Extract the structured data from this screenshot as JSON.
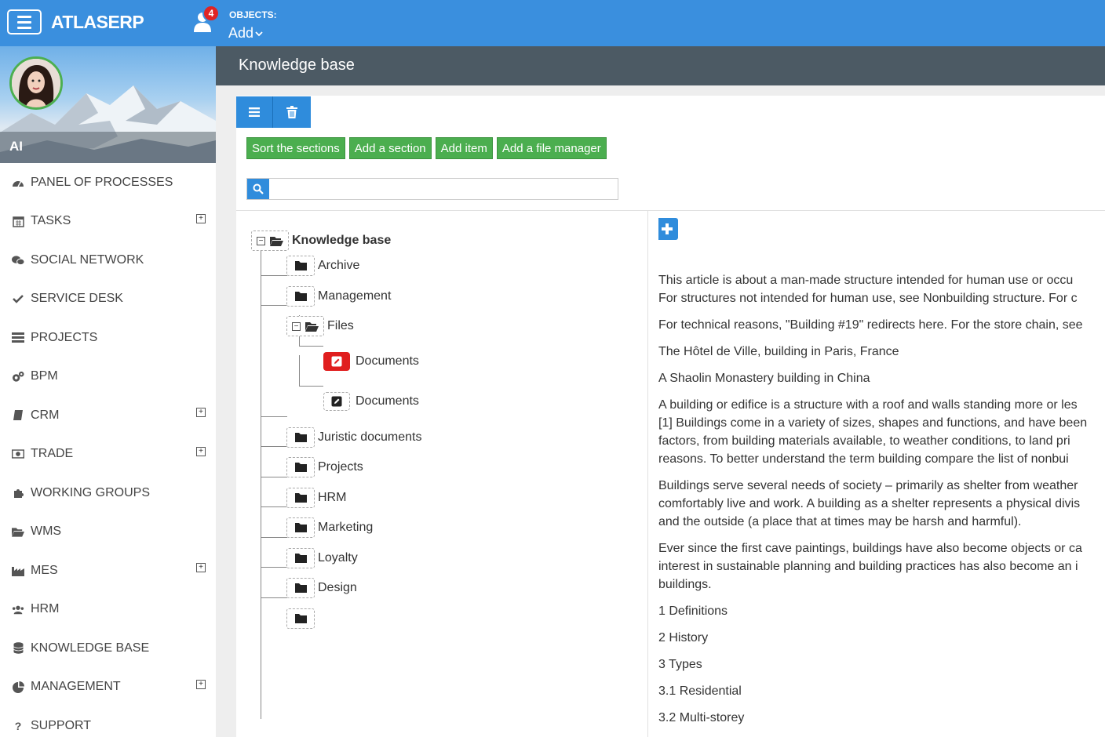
{
  "app": {
    "brand": "ATLASERP",
    "notification_count": "4",
    "objects_label": "OBJECTS:",
    "objects_add": "Add"
  },
  "profile": {
    "name": "AI"
  },
  "menu": [
    {
      "label": "PANEL OF PROCESSES",
      "icon": "dashboard-icon",
      "expandable": false
    },
    {
      "label": "TASKS",
      "icon": "calendar-icon",
      "expandable": true
    },
    {
      "label": "SOCIAL NETWORK",
      "icon": "chat-icon",
      "expandable": false
    },
    {
      "label": "SERVICE DESK",
      "icon": "check-icon",
      "expandable": false
    },
    {
      "label": "PROJECTS",
      "icon": "list-icon",
      "expandable": false
    },
    {
      "label": "BPM",
      "icon": "gears-icon",
      "expandable": false
    },
    {
      "label": "CRM",
      "icon": "book-icon",
      "expandable": true
    },
    {
      "label": "TRADE",
      "icon": "money-icon",
      "expandable": true
    },
    {
      "label": "WORKING GROUPS",
      "icon": "puzzle-icon",
      "expandable": false
    },
    {
      "label": "WMS",
      "icon": "folder-open-icon",
      "expandable": false
    },
    {
      "label": "MES",
      "icon": "factory-icon",
      "expandable": true
    },
    {
      "label": "HRM",
      "icon": "users-icon",
      "expandable": false
    },
    {
      "label": "KNOWLEDGE BASE",
      "icon": "database-icon",
      "expandable": false
    },
    {
      "label": "MANAGEMENT",
      "icon": "pie-chart-icon",
      "expandable": true
    },
    {
      "label": "SUPPORT",
      "icon": "question-icon",
      "expandable": false
    }
  ],
  "page": {
    "title": "Knowledge base"
  },
  "toolbar": {
    "sort_sections": "Sort the sections",
    "add_section": "Add a section",
    "add_item": "Add item",
    "add_file_manager": "Add a file manager"
  },
  "search": {
    "value": "",
    "placeholder": ""
  },
  "tree": {
    "root": "Knowledge base",
    "archive": "Archive",
    "management": "Management",
    "files": "Files",
    "doc1": "Documents",
    "doc2": "Documents",
    "juristic": "Juristic documents",
    "projects": "Projects",
    "hrm": "HRM",
    "marketing": "Marketing",
    "loyalty": "Loyalty",
    "design": "Design",
    "unnamed": ""
  },
  "article": {
    "paragraphs": [
      "This article is about a man-made structure intended for human use or occu",
      "For structures not intended for human use, see Nonbuilding structure. For c",
      "For technical reasons, \"Building #19\" redirects here. For the store chain, see",
      "The Hôtel de Ville, building in Paris, France",
      "A Shaolin Monastery building in China",
      "A building or edifice is a structure with a roof and walls standing more or les",
      "[1] Buildings come in a variety of sizes, shapes and functions, and have been",
      "factors, from building materials available, to weather conditions, to land pri",
      "reasons. To better understand the term building compare the list of nonbui",
      "Buildings serve several needs of society – primarily as shelter from weather",
      "comfortably live and work. A building as a shelter represents a physical divis",
      "and the outside (a place that at times may be harsh and harmful).",
      "Ever since the first cave paintings, buildings have also become objects or ca",
      "interest in sustainable planning and building practices has also become an i",
      "buildings.",
      "1 Definitions",
      "2 History",
      "3 Types",
      "3.1 Residential",
      "3.2 Multi-storey"
    ]
  }
}
